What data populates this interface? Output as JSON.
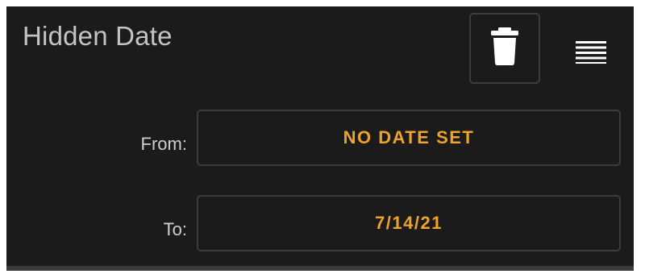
{
  "colors": {
    "panel_background": "#1b1b1b",
    "button_border": "#3c3c3c",
    "date_value_text": "#f0a32a",
    "title_text": "#c4c4c4",
    "label_text": "#cfcfcf",
    "icon_color": "#ffffff"
  },
  "header": {
    "title": "Hidden Date",
    "delete_icon": "trash-icon",
    "menu_icon": "drag-handle-icon"
  },
  "fields": [
    {
      "label": "From:",
      "value": "NO DATE SET"
    },
    {
      "label": "To:",
      "value": "7/14/21"
    }
  ]
}
